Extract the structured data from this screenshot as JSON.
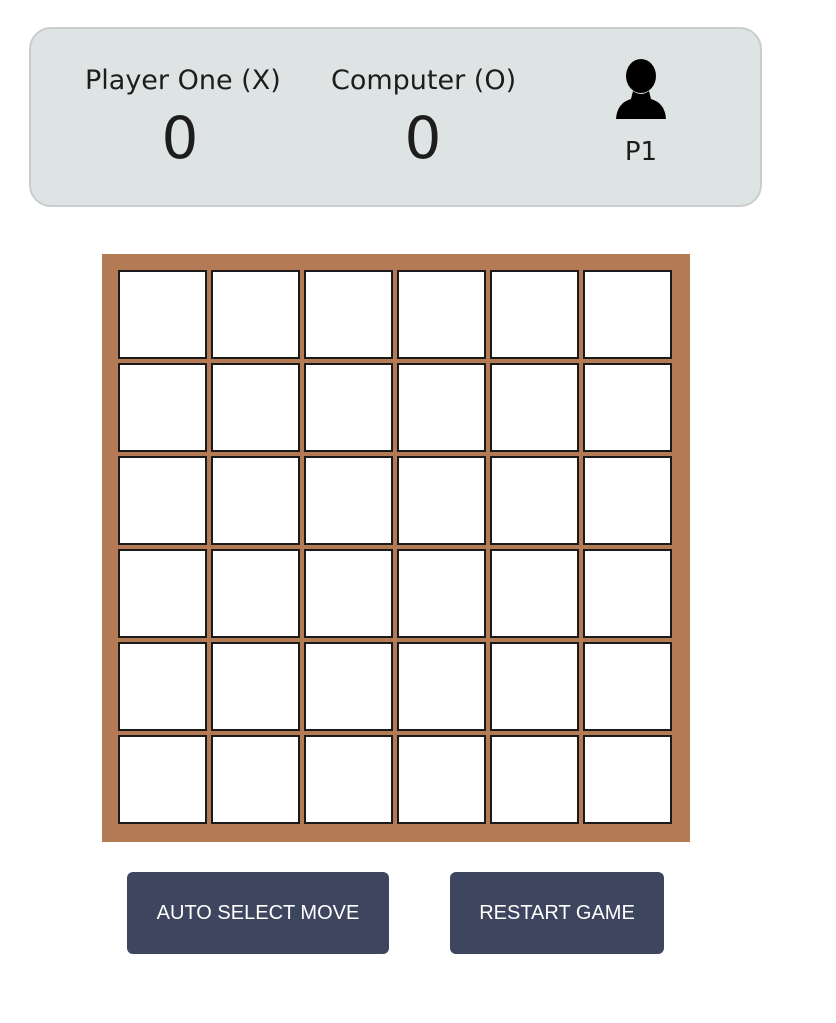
{
  "scoreboard": {
    "player_one": {
      "name": "Player One (X)",
      "score": "0"
    },
    "computer": {
      "name": "Computer (O)",
      "score": "0"
    },
    "turn": {
      "icon": "person-icon",
      "label": "P1"
    }
  },
  "board": {
    "rows": 6,
    "cols": 6,
    "cells": [
      [
        "",
        "",
        "",
        "",
        "",
        ""
      ],
      [
        "",
        "",
        "",
        "",
        "",
        ""
      ],
      [
        "",
        "",
        "",
        "",
        "",
        ""
      ],
      [
        "",
        "",
        "",
        "",
        "",
        ""
      ],
      [
        "",
        "",
        "",
        "",
        "",
        ""
      ],
      [
        "",
        "",
        "",
        "",
        "",
        ""
      ]
    ],
    "frame_color": "#b37a55"
  },
  "controls": {
    "auto_select_label": "AUTO SELECT MOVE",
    "restart_label": "RESTART GAME",
    "button_color": "#3d465e"
  }
}
